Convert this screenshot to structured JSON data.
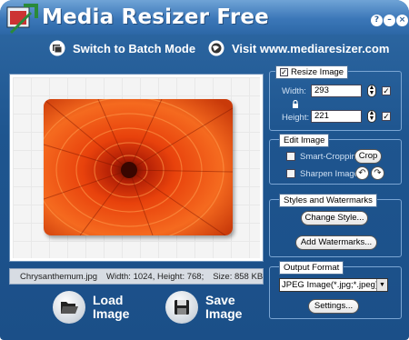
{
  "app": {
    "title": "Media Resizer Free"
  },
  "window_buttons": {
    "help": "?",
    "minimize": "–",
    "close": "×"
  },
  "toolbar": {
    "batch_label": "Switch to Batch Mode",
    "visit_label": "Visit www.mediaresizer.com"
  },
  "status": {
    "filename": "Chrysanthemum.jpg",
    "dimensions": "Width: 1024, Height: 768;",
    "size": "Size: 858 KB"
  },
  "actions": {
    "load_label": "Load Image",
    "save_label": "Save Image"
  },
  "resize": {
    "title": "Resize Image",
    "enabled": true,
    "width_label": "Width:",
    "width_value": "293",
    "height_label": "Height:",
    "height_value": "221"
  },
  "edit": {
    "title": "Edit Image",
    "smart_crop_label": "Smart-Cropping",
    "crop_label": "Crop",
    "sharpen_label": "Sharpen Image"
  },
  "styles": {
    "title": "Styles and Watermarks",
    "change_style_label": "Change Style...",
    "add_watermarks_label": "Add Watermarks..."
  },
  "output": {
    "title": "Output Format",
    "format_value": "JPEG Image(*.jpg;*.jpeg)",
    "settings_label": "Settings..."
  }
}
